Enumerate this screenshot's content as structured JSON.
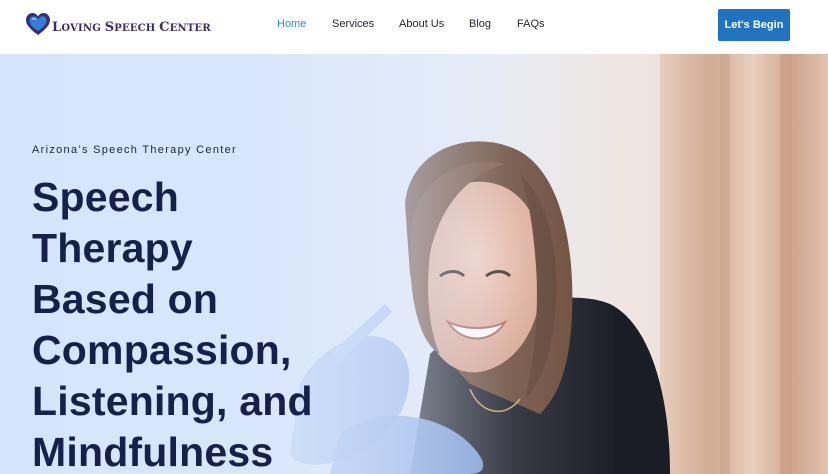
{
  "brand": {
    "name_parts": [
      {
        "text": "L",
        "size": "big"
      },
      {
        "text": "OVING ",
        "size": "small"
      },
      {
        "text": "S",
        "size": "big"
      },
      {
        "text": "PEECH ",
        "size": "small"
      },
      {
        "text": "C",
        "size": "big"
      },
      {
        "text": "ENTER",
        "size": "small"
      }
    ],
    "icon": "heart-logo-icon",
    "colors": {
      "logo_text": "#3a2a66",
      "heart_outer": "#3b2b78",
      "heart_inner": "#2f7fd3"
    }
  },
  "nav": {
    "items": [
      {
        "label": "Home",
        "active": true
      },
      {
        "label": "Services",
        "active": false
      },
      {
        "label": "About Us",
        "active": false
      },
      {
        "label": "Blog",
        "active": false
      },
      {
        "label": "FAQs",
        "active": false
      }
    ]
  },
  "header": {
    "cta_label": "Let's Begin"
  },
  "hero": {
    "eyebrow": "Arizona’s Speech Therapy Center",
    "headline_lines": [
      "Speech",
      "Therapy",
      "Based on",
      "Compassion,",
      "Listening, and",
      "Mindfulness"
    ],
    "photo": "speech-therapist-smiling-with-gloved-hands-photo"
  },
  "colors": {
    "nav_active": "#2c8bd4",
    "nav_text": "#1f2330",
    "cta_bg": "#1f73c0",
    "headline": "#16204a",
    "hero_bg": "#dfe9fb"
  }
}
